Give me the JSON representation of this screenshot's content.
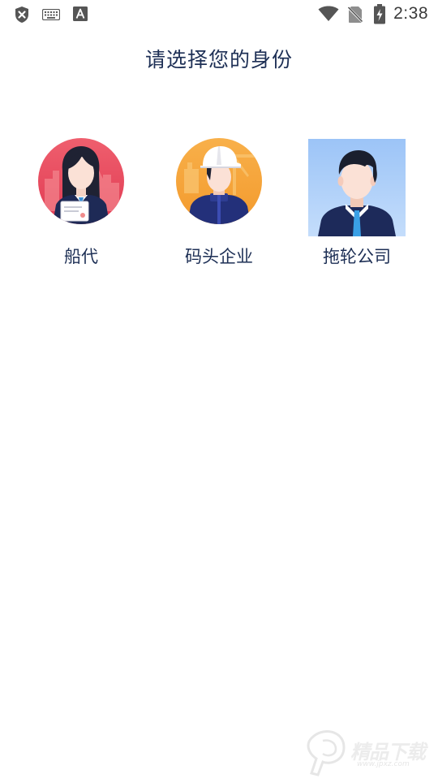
{
  "status_bar": {
    "time": "2:38",
    "left_icons": [
      "shield-x-icon",
      "keyboard-icon",
      "font-a-icon"
    ],
    "right_icons": [
      "wifi-icon",
      "no-sim-icon",
      "battery-charging-icon"
    ]
  },
  "page": {
    "title": "请选择您的身份"
  },
  "identities": [
    {
      "label": "船代",
      "avatar": "ship-agent-woman-avatar",
      "bg_color": "#e8485e"
    },
    {
      "label": "码头企业",
      "avatar": "dock-worker-helmet-avatar",
      "bg_color": "#f5a03a"
    },
    {
      "label": "拖轮公司",
      "avatar": "tugboat-company-man-avatar",
      "bg_color": "#a8cdf8"
    }
  ],
  "watermark": {
    "text": "精品下载",
    "url_text": "www.jpxz.com"
  },
  "colors": {
    "title_text": "#1d2f55",
    "status_icons": "#555555"
  }
}
